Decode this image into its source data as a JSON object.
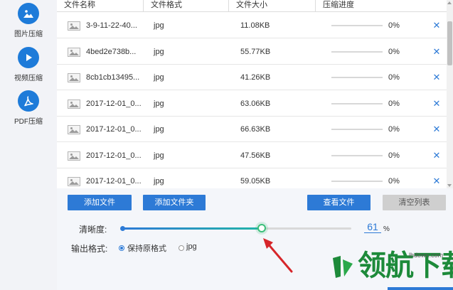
{
  "sidebar": {
    "items": [
      {
        "label": "图片压缩",
        "icon": "image-compress-icon"
      },
      {
        "label": "视频压缩",
        "icon": "video-play-icon"
      },
      {
        "label": "PDF压缩",
        "icon": "pdf-acrobat-icon"
      }
    ]
  },
  "table": {
    "headers": [
      "文件名称",
      "文件格式",
      "文件大小",
      "压缩进度"
    ],
    "rows": [
      {
        "name": "3-9-11-22-40...",
        "format": "jpg",
        "size": "11.08KB",
        "progress": "0%",
        "progress_value": 0
      },
      {
        "name": "4bed2e738b...",
        "format": "jpg",
        "size": "55.77KB",
        "progress": "0%",
        "progress_value": 0
      },
      {
        "name": "8cb1cb13495...",
        "format": "jpg",
        "size": "41.26KB",
        "progress": "0%",
        "progress_value": 0
      },
      {
        "name": "2017-12-01_0...",
        "format": "jpg",
        "size": "63.06KB",
        "progress": "0%",
        "progress_value": 0
      },
      {
        "name": "2017-12-01_0...",
        "format": "jpg",
        "size": "66.63KB",
        "progress": "0%",
        "progress_value": 0
      },
      {
        "name": "2017-12-01_0...",
        "format": "jpg",
        "size": "47.56KB",
        "progress": "0%",
        "progress_value": 0
      },
      {
        "name": "2017-12-01_0...",
        "format": "jpg",
        "size": "59.05KB",
        "progress": "0%",
        "progress_value": 0
      }
    ],
    "delete_glyph": "✕"
  },
  "buttons": {
    "add_file": "添加文件",
    "add_folder": "添加文件夹",
    "view_file": "查看文件",
    "clear_list": "清空列表"
  },
  "quality": {
    "label": "清晰度:",
    "value": "61",
    "unit": "%",
    "fraction": 0.61
  },
  "output": {
    "label": "输出格式:",
    "options": [
      {
        "label": "保持原格式",
        "selected": true
      },
      {
        "label": "jpg",
        "selected": false
      }
    ]
  },
  "watermark": {
    "title": "领航下载",
    "url": "lhdown.com"
  },
  "colors": {
    "accent": "#2d7ad6",
    "slider_end": "#23b5a8",
    "knob": "#3bbf7a",
    "annotation_arrow": "#d6262a",
    "watermark": "#1d8a3a"
  }
}
